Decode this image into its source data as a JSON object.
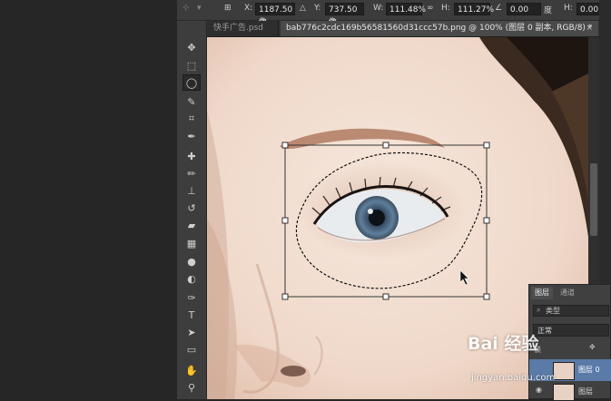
{
  "options_bar": {
    "x_label": "X:",
    "x_value": "1187.50 像",
    "y_label": "Y:",
    "y_value": "737.50 像",
    "w_label": "W:",
    "w_value": "111.48%",
    "h_label": "H:",
    "h_value": "111.27%",
    "angle_value": "0.00",
    "angle_unit": "度",
    "h2_label": "H:",
    "h2_value": "0.00"
  },
  "tabs": {
    "inactive": "快手广告.psd",
    "active": "bab776c2cdc169b56581560d31ccc57b.png @ 100% (图层 0 副本, RGB/8) *"
  },
  "layers_panel": {
    "tab_layers": "图层",
    "tab_channels": "通道",
    "filter_placeholder": "类型",
    "blend_mode": "正常",
    "lock_label": "锁",
    "layer1_name": "图层 0",
    "layer2_name": "图层"
  },
  "watermark": {
    "brand": "Bai 经验",
    "url": "jingyan.baidu.com"
  },
  "colors": {
    "ui_dark": "#262626",
    "panel": "#3d3d3d",
    "skin": "#f0ddd0",
    "iris": "#5a7a96"
  }
}
